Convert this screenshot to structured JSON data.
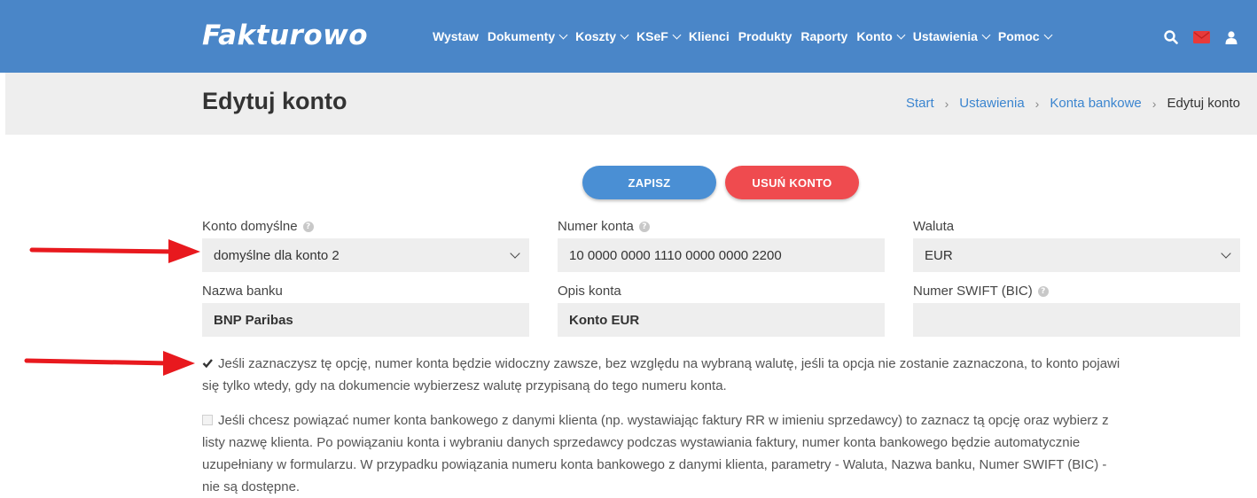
{
  "app": {
    "logo": "Fakturowo",
    "accent": "#4a86c8"
  },
  "nav": [
    {
      "label": "Wystaw",
      "dropdown": false
    },
    {
      "label": "Dokumenty",
      "dropdown": true
    },
    {
      "label": "Koszty",
      "dropdown": true
    },
    {
      "label": "KSeF",
      "dropdown": true
    },
    {
      "label": "Klienci",
      "dropdown": false
    },
    {
      "label": "Produkty",
      "dropdown": false
    },
    {
      "label": "Raporty",
      "dropdown": false
    },
    {
      "label": "Konto",
      "dropdown": true
    },
    {
      "label": "Ustawienia",
      "dropdown": true
    },
    {
      "label": "Pomoc",
      "dropdown": true
    }
  ],
  "top_icons": [
    "search-icon",
    "mail-icon",
    "user-icon"
  ],
  "page": {
    "title": "Edytuj konto"
  },
  "breadcrumb": [
    "Start",
    "Ustawienia",
    "Konta bankowe",
    "Edytuj konto"
  ],
  "actions": {
    "save": "ZAPISZ",
    "delete": "USUŃ KONTO",
    "save_color": "#4a8fd4",
    "delete_color": "#ef4b4f"
  },
  "form": {
    "default_account": {
      "label": "Konto domyślne",
      "value": "domyślne dla konto 2"
    },
    "account_number": {
      "label": "Numer konta",
      "value": "10 0000 0000 1110 0000 0000 2200"
    },
    "currency": {
      "label": "Waluta",
      "value": "EUR"
    },
    "bank_name": {
      "label": "Nazwa banku",
      "value": "BNP Paribas"
    },
    "description": {
      "label": "Opis konta",
      "value": "Konto EUR"
    },
    "swift": {
      "label": "Numer SWIFT (BIC)",
      "value": ""
    }
  },
  "options": {
    "always_visible": {
      "checked": true,
      "line1": "Jeśli zaznaczysz tę opcję, numer konta będzie widoczny zawsze, bez względu na wybraną walutę, jeśli ta opcja nie zostanie zaznaczona, to konto pojawi",
      "line2": "się tylko wtedy, gdy na dokumencie wybierzesz walutę przypisaną do tego numeru konta."
    },
    "link_client": {
      "checked": false,
      "line1": "Jeśli chcesz powiązać numer konta bankowego z danymi klienta (np. wystawiając faktury RR w imieniu sprzedawcy) to zaznacz tą opcję oraz wybierz z",
      "line2": "listy nazwę klienta. Po powiązaniu konta i wybraniu danych sprzedawcy podczas wystawiania faktury, numer konta bankowego będzie automatycznie",
      "line3": "uzupełniany w formularzu. W przypadku powiązania numeru konta bankowego z danymi klienta, parametry - Waluta, Nazwa banku, Numer SWIFT (BIC) -",
      "line4": "nie są dostępne."
    }
  },
  "annotation_color": "#e8191e"
}
